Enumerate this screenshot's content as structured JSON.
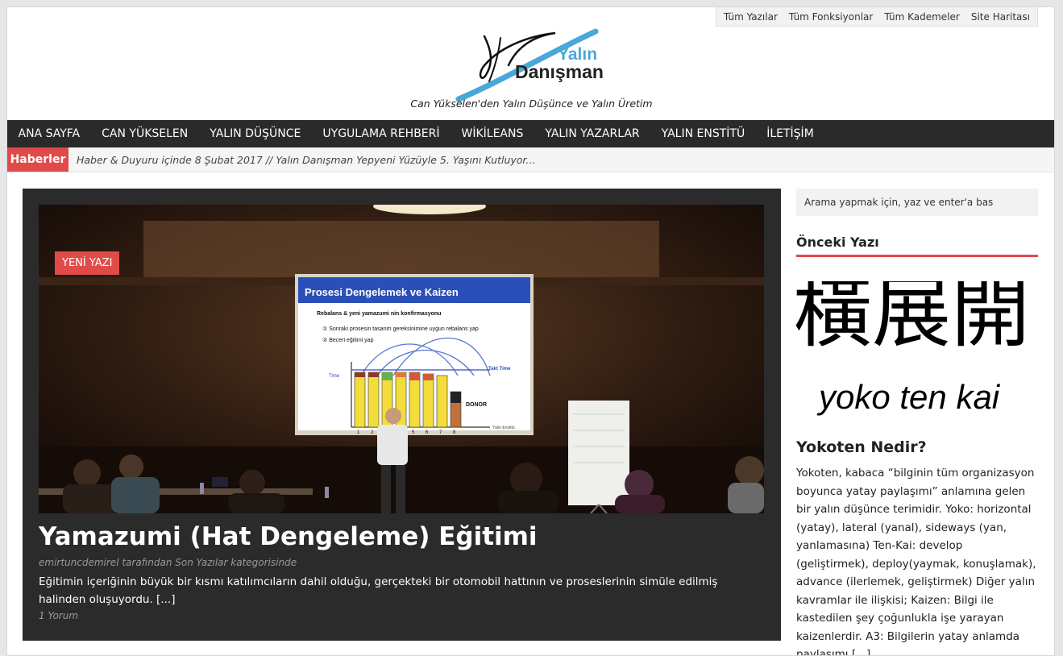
{
  "top_links": [
    "Tüm Yazılar",
    "Tüm Fonksiyonlar",
    "Tüm Kademeler",
    "Site Haritası"
  ],
  "logo": {
    "line1": "Yalın",
    "line2": "Danışman"
  },
  "tagline": "Can Yükselen'den Yalın Düşünce ve Yalın Üretim",
  "nav": [
    "ANA SAYFA",
    "CAN YÜKSELEN",
    "YALIN DÜŞÜNCE",
    "UYGULAMA REHBERİ",
    "WİKİLEANS",
    "YALIN YAZARLAR",
    "YALIN ENSTİTÜ",
    "İLETİŞİM"
  ],
  "news": {
    "label": "Haberler",
    "text": "Haber & Duyuru içinde 8 Şubat 2017 // Yalın Danışman Yepyeni Yüzüyle 5. Yaşını Kutluyor..."
  },
  "feature": {
    "badge": "YENİ YAZI",
    "title": "Yamazumi (Hat Dengeleme) Eğitimi",
    "meta": "emirtuncdemirel tarafından Son Yazılar kategorisinde",
    "excerpt": "Eğitimin içeriğinin büyük bir kısmı katılımcıların dahil olduğu, gerçekteki bir otomobil hattının ve proseslerinin simüle edilmiş halinden oluşuyordu.",
    "more": "[...]",
    "comments": "1 Yorum",
    "slide": {
      "title": "Prosesi Dengelemek ve Kaizen",
      "subtitle": "Rebalans & yeni yamazumi nin konfirmasyonu",
      "item1": "① Sonraki prosesin tasarım gereksinimine uygun rebalans yap",
      "item2": "② Beceri eğitimi yap",
      "takt": "Takt Time",
      "time": "Time",
      "donor": "DONOR",
      "axis": [
        "1",
        "2",
        "3",
        "4",
        "5",
        "6",
        "7",
        "8"
      ],
      "footer": "Yalın Enstitü"
    }
  },
  "sidebar": {
    "search_placeholder": "Arama yapmak için, yaz ve enter'a bas",
    "widget_title": "Önceki Yazı",
    "kanji": "橫展開",
    "romaji": "yoko ten kai",
    "post_title": "Yokoten Nedir?",
    "post_excerpt": "Yokoten, kabaca “bilginin tüm organizasyon boyunca yatay paylaşımı” anlamına gelen bir yalın düşünce terimidir. Yoko: horizontal (yatay), lateral (yanal), sideways (yan, yanlamasına) Ten-Kai: develop (geliştirmek), deploy(yaymak, konuşlamak), advance (ilerlemek, geliştirmek) Diğer yalın kavramlar ile ilişkisi; Kaizen: Bilgi ile kastedilen şey çoğunlukla işe yarayan kaizenlerdir. A3: Bilgilerin yatay anlamda paylaşımı",
    "more": "[...]"
  },
  "colors": {
    "accent": "#e04b4a",
    "nav_bg": "#2a2a2a",
    "feature_bg": "#2b2b2b",
    "logo_blue": "#4aa8d8"
  }
}
